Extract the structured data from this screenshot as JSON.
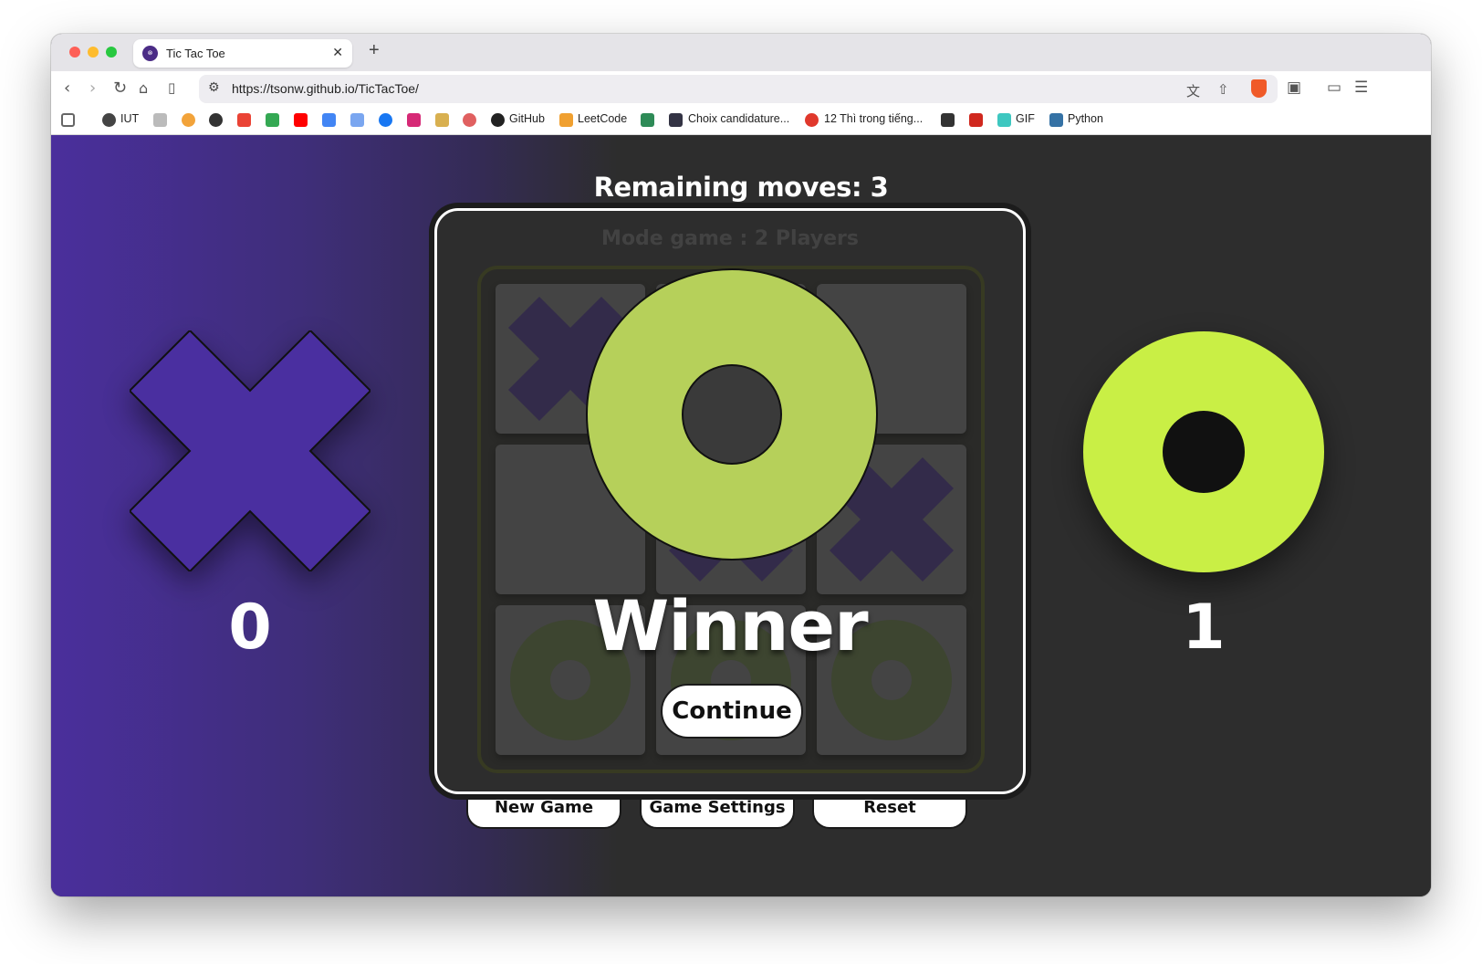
{
  "browser": {
    "tab_title": "Tic Tac Toe",
    "tab_favicon": "tic-tac-toe-favicon",
    "close_glyph": "✕",
    "new_tab_glyph": "+",
    "url": "https://tsonw.github.io/TicTacToe/",
    "bookmarks": [
      {
        "label": "IUT",
        "icon": "globe-icon"
      },
      {
        "label": "GitHub",
        "icon": "github-icon"
      },
      {
        "label": "LeetCode",
        "icon": "leetcode-icon"
      },
      {
        "label": "Choix candidature...",
        "icon": "candidature-icon"
      },
      {
        "label": "12 Thì trong tiếng...",
        "icon": "grammar-icon"
      },
      {
        "label": "GIF",
        "icon": "gif-icon"
      },
      {
        "label": "Python",
        "icon": "python-icon"
      }
    ]
  },
  "game": {
    "remaining_label": "Remaining moves:",
    "remaining_value": "3",
    "mode_label": "Mode game : 2 Players",
    "score_x": "0",
    "score_o": "1",
    "winner_label": "Winner",
    "continue_label": "Continue",
    "buttons": {
      "new_game": "New Game",
      "settings": "Game Settings",
      "reset": "Reset"
    },
    "board": [
      "X",
      "",
      "",
      "",
      "X",
      "X",
      "O",
      "O",
      "O"
    ],
    "winner_symbol": "O"
  },
  "colors": {
    "x_color": "#4a2fa0",
    "o_color": "#c9ef45",
    "o_overlay": "#b6d05a",
    "board_x_dim": "#332b4a",
    "board_o_dim": "#3d4530"
  }
}
